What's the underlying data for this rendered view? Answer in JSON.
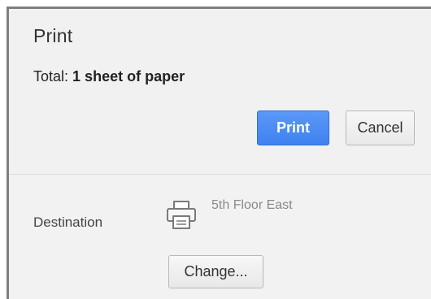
{
  "dialog": {
    "title": "Print",
    "total_label": "Total:",
    "total_value": "1 sheet of paper"
  },
  "buttons": {
    "print_label": "Print",
    "cancel_label": "Cancel",
    "change_label": "Change..."
  },
  "destination": {
    "label": "Destination",
    "printer_name": "5th Floor East",
    "icon": "printer-icon"
  },
  "colors": {
    "print_button": "#4c8ef7",
    "panel_background": "#f2f2f2"
  }
}
